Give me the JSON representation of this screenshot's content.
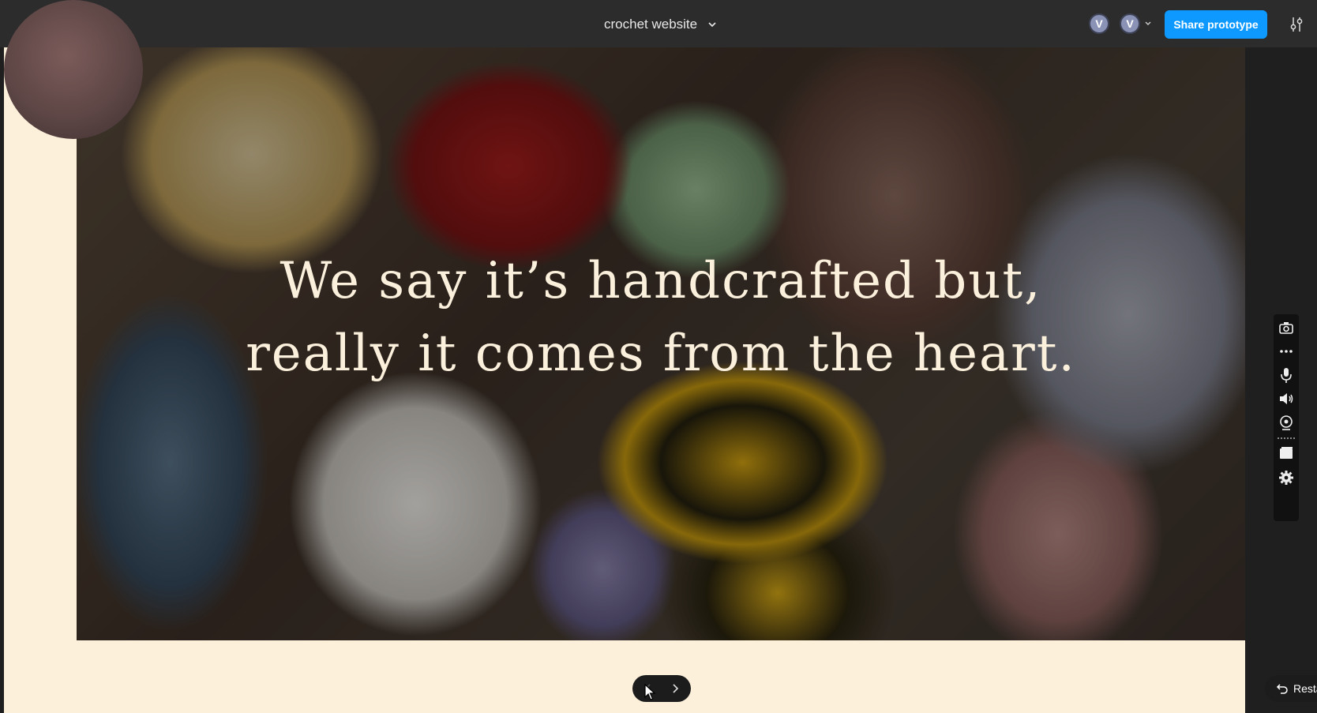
{
  "topbar": {
    "file_title": "crochet website",
    "avatars": [
      "V",
      "V"
    ],
    "share_label": "Share prototype"
  },
  "hero": {
    "line1": "We say it’s handcrafted but,",
    "line2": "really it comes from the heart."
  },
  "footer": {
    "restart_label": "Resta"
  },
  "colors": {
    "share_button": "#0d99ff",
    "canvas_bg": "#fdf0db",
    "hero_text": "#fbf0dc",
    "topbar_bg": "#2c2c2c"
  },
  "icons": {
    "settings": "settings-sliders-icon",
    "recorder": [
      "camera-icon",
      "more-icon",
      "microphone-icon",
      "speaker-icon",
      "webcam-icon",
      "screen-icon",
      "gear-icon"
    ]
  }
}
